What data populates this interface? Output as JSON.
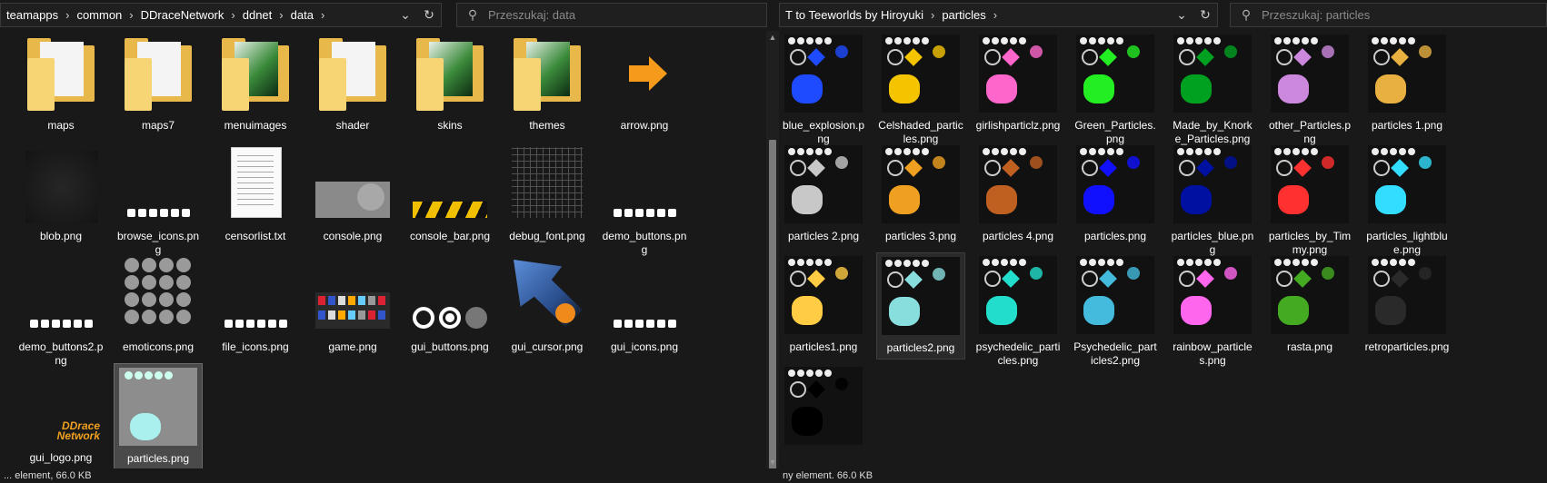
{
  "left": {
    "breadcrumb": [
      "teamapps",
      "common",
      "DDraceNetwork",
      "ddnet",
      "data"
    ],
    "search_placeholder": "Przeszukaj: data",
    "status": "... element, 66.0 KB",
    "items": [
      {
        "name": "maps",
        "kind": "folder"
      },
      {
        "name": "maps7",
        "kind": "folder"
      },
      {
        "name": "menuimages",
        "kind": "folder-image"
      },
      {
        "name": "shader",
        "kind": "folder"
      },
      {
        "name": "skins",
        "kind": "folder-image"
      },
      {
        "name": "themes",
        "kind": "folder-image"
      },
      {
        "name": "arrow.png",
        "kind": "arrow"
      },
      {
        "name": "blob.png",
        "kind": "dark"
      },
      {
        "name": "browse_icons.png",
        "kind": "icons"
      },
      {
        "name": "censorlist.txt",
        "kind": "txt"
      },
      {
        "name": "console.png",
        "kind": "console"
      },
      {
        "name": "console_bar.png",
        "kind": "bar"
      },
      {
        "name": "debug_font.png",
        "kind": "font"
      },
      {
        "name": "demo_buttons.png",
        "kind": "icons"
      },
      {
        "name": "demo_buttons2.png",
        "kind": "icons"
      },
      {
        "name": "emoticons.png",
        "kind": "emoticons"
      },
      {
        "name": "file_icons.png",
        "kind": "icons"
      },
      {
        "name": "game.png",
        "kind": "game"
      },
      {
        "name": "gui_buttons.png",
        "kind": "circles"
      },
      {
        "name": "gui_cursor.png",
        "kind": "cursor"
      },
      {
        "name": "gui_icons.png",
        "kind": "icons"
      },
      {
        "name": "gui_logo.png",
        "kind": "logo"
      },
      {
        "name": "particles.png",
        "kind": "particles-grey",
        "selected": true
      }
    ],
    "logo_text": "DDrace Network"
  },
  "right": {
    "breadcrumb": [
      "T to Teeworlds by Hiroyuki",
      "particles"
    ],
    "search_placeholder": "Przeszukaj: particles",
    "status": "ny element. 66.0 KB",
    "items": [
      {
        "name": "blue_explosion.png",
        "accent": "#1e4bff"
      },
      {
        "name": "Celshaded_particles.png",
        "accent": "#f5c400"
      },
      {
        "name": "girlishparticlz.png",
        "accent": "#ff66cc"
      },
      {
        "name": "Green_Particles.png",
        "accent": "#22ee22"
      },
      {
        "name": "Made_by_Knorke_Particles.png",
        "accent": "#00a020"
      },
      {
        "name": "other_Particles.png",
        "accent": "#cc88dd"
      },
      {
        "name": "particles 1.png",
        "accent": "#e8b040"
      },
      {
        "name": "particles 2.png",
        "accent": "#c8c8c8"
      },
      {
        "name": "particles 3.png",
        "accent": "#f0a020"
      },
      {
        "name": "particles 4.png",
        "accent": "#c06020"
      },
      {
        "name": "particles.png",
        "accent": "#1010ff"
      },
      {
        "name": "particles_blue.png",
        "accent": "#0010a0"
      },
      {
        "name": "particles_by_Timmy.png",
        "accent": "#ff3030"
      },
      {
        "name": "particles_lightblue.png",
        "accent": "#33ddff"
      },
      {
        "name": "particles1.png",
        "accent": "#ffcc44"
      },
      {
        "name": "particles2.png",
        "accent": "#88dddd",
        "hover": true
      },
      {
        "name": "psychedelic_particles.png",
        "accent": "#22ddcc"
      },
      {
        "name": "Psychedelic_particles2.png",
        "accent": "#44bbdd"
      },
      {
        "name": "rainbow_particles.png",
        "accent": "#ff66ee"
      },
      {
        "name": "rasta.png",
        "accent": "#44aa22"
      },
      {
        "name": "retroparticles.png",
        "accent": "#2a2a2a"
      },
      {
        "name": "",
        "accent": "#000000"
      }
    ]
  },
  "icons": {
    "chevron": "chevron-down-icon",
    "refresh": "refresh-icon",
    "search": "search-icon"
  }
}
